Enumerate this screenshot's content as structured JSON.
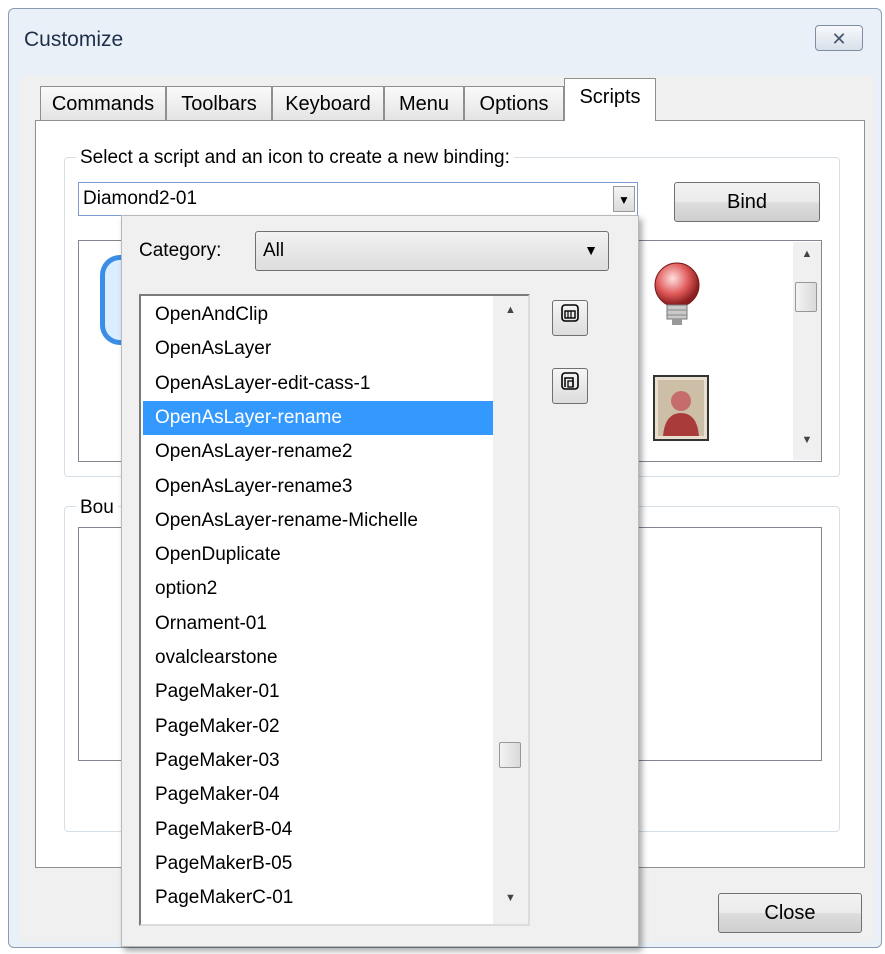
{
  "window": {
    "title": "Customize",
    "close_glyph": "✕"
  },
  "tabs": [
    {
      "label": "Commands",
      "active": false
    },
    {
      "label": "Toolbars",
      "active": false
    },
    {
      "label": "Keyboard",
      "active": false
    },
    {
      "label": "Menu",
      "active": false
    },
    {
      "label": "Options",
      "active": false
    },
    {
      "label": "Scripts",
      "active": true
    }
  ],
  "binding": {
    "group_label": "Select a script and an icon to create a new binding:",
    "script_value": "Diamond2-01",
    "bind_label": "Bind",
    "icons": [
      "frame-icon",
      "lightbulb-icon",
      "person-icon"
    ]
  },
  "bound": {
    "group_label": "Bou"
  },
  "popup": {
    "category_label": "Category:",
    "category_value": "All",
    "items": [
      "OpenAndClip",
      "OpenAsLayer",
      "OpenAsLayer-edit-cass-1",
      "OpenAsLayer-rename",
      "OpenAsLayer-rename2",
      "OpenAsLayer-rename3",
      "OpenAsLayer-rename-Michelle",
      "OpenDuplicate",
      "option2",
      "Ornament-01",
      "ovalclearstone",
      "PageMaker-01",
      "PageMaker-02",
      "PageMaker-03",
      "PageMaker-04",
      "PageMakerB-04",
      "PageMakerB-05",
      "PageMakerC-01"
    ],
    "selected_index": 3,
    "side_buttons": [
      "list-view-icon",
      "icon-view-icon"
    ]
  },
  "footer": {
    "close_label": "Close"
  },
  "colors": {
    "selection": "#3399ff",
    "window_bg": "#eaf0f8"
  }
}
